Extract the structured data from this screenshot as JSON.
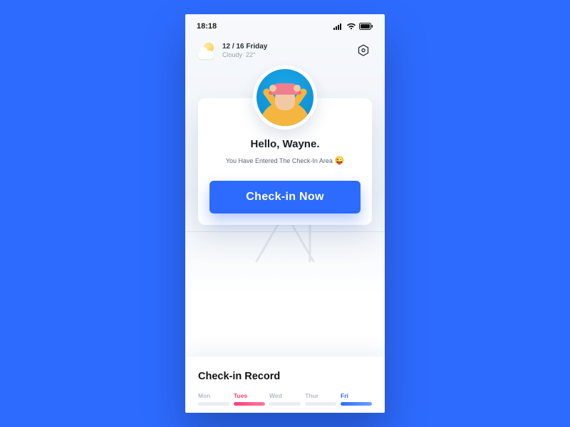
{
  "status": {
    "time": "18:18"
  },
  "weather": {
    "date": "12 / 16  Friday",
    "condition": "Cloudy",
    "temp": "22°"
  },
  "card": {
    "greeting": "Hello, Wayne.",
    "subtext": "You Have Entered The Check-In Area",
    "emoji": "😜",
    "button_label": "Check-in  Now"
  },
  "record": {
    "title": "Check-in Record",
    "days": [
      {
        "label": "Mon",
        "state": "none"
      },
      {
        "label": "Tues",
        "state": "pink"
      },
      {
        "label": "Wed",
        "state": "none"
      },
      {
        "label": "Thur",
        "state": "none"
      },
      {
        "label": "Fri",
        "state": "blue"
      }
    ]
  }
}
